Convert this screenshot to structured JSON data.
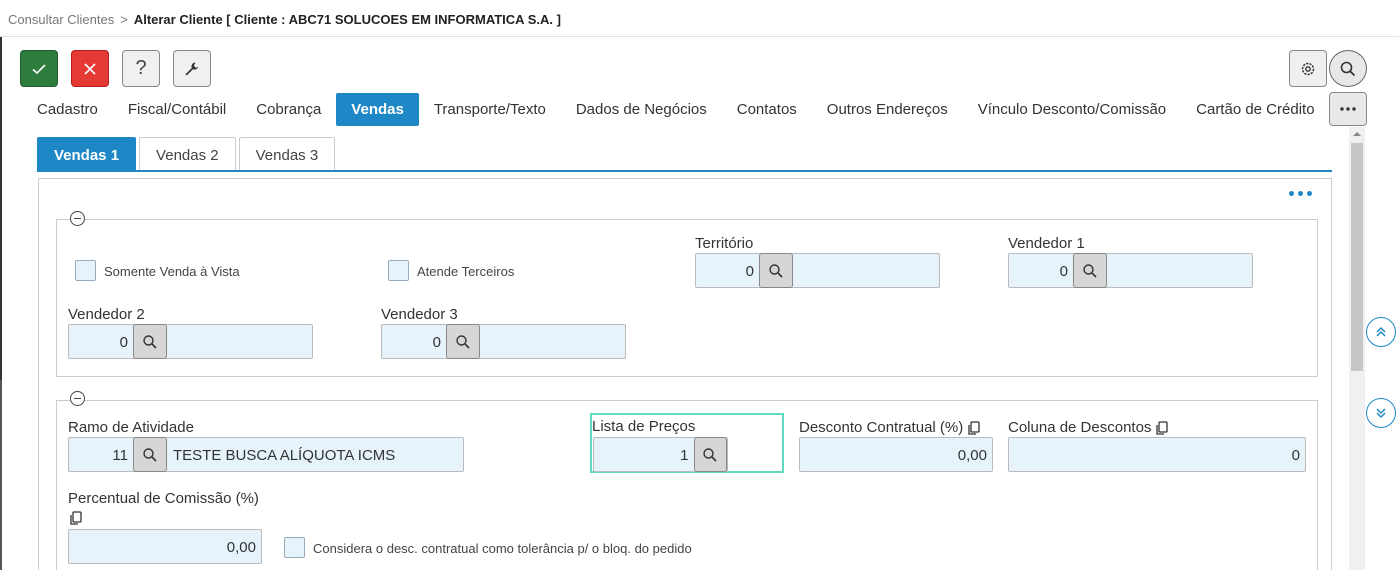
{
  "breadcrumb": {
    "parent": "Consultar Clientes",
    "separator": ">",
    "current": "Alterar Cliente [ Cliente : ABC71 SOLUCOES EM INFORMATICA S.A. ]"
  },
  "toolbar": {
    "help_label": "?"
  },
  "main_tabs": [
    {
      "label": "Cadastro"
    },
    {
      "label": "Fiscal/Contábil"
    },
    {
      "label": "Cobrança"
    },
    {
      "label": "Vendas"
    },
    {
      "label": "Transporte/Texto"
    },
    {
      "label": "Dados de Negócios"
    },
    {
      "label": "Contatos"
    },
    {
      "label": "Outros Endereços"
    },
    {
      "label": "Vínculo Desconto/Comissão"
    },
    {
      "label": "Cartão de Crédito"
    }
  ],
  "sub_tabs": [
    {
      "label": "Vendas 1"
    },
    {
      "label": "Vendas 2"
    },
    {
      "label": "Vendas 3"
    }
  ],
  "group1": {
    "somente_venda_vista": "Somente Venda à Vista",
    "atende_terceiros": "Atende Terceiros",
    "territorio": {
      "label": "Território",
      "value": "0",
      "desc": ""
    },
    "vendedor1": {
      "label": "Vendedor 1",
      "value": "0",
      "desc": ""
    },
    "vendedor2": {
      "label": "Vendedor 2",
      "value": "0",
      "desc": ""
    },
    "vendedor3": {
      "label": "Vendedor 3",
      "value": "0",
      "desc": ""
    }
  },
  "group2": {
    "ramo": {
      "label": "Ramo de Atividade",
      "value": "11",
      "desc": "TESTE BUSCA ALÍQUOTA ICMS"
    },
    "lista": {
      "label": "Lista de Preços",
      "value": "1"
    },
    "desconto": {
      "label": "Desconto Contratual (%)",
      "value": "0,00"
    },
    "coluna": {
      "label": "Coluna de Descontos",
      "value": "0"
    },
    "comissao": {
      "label": "Percentual de Comissão (%)",
      "value": "0,00"
    },
    "considera": "Considera o desc. contratual como tolerância p/ o bloq. do pedido"
  },
  "colors": {
    "accent": "#1e88c7",
    "ok": "#2e7d3e",
    "cancel": "#e53935",
    "field_bg": "#e6f3fb",
    "focus": "#5fdcc0"
  }
}
